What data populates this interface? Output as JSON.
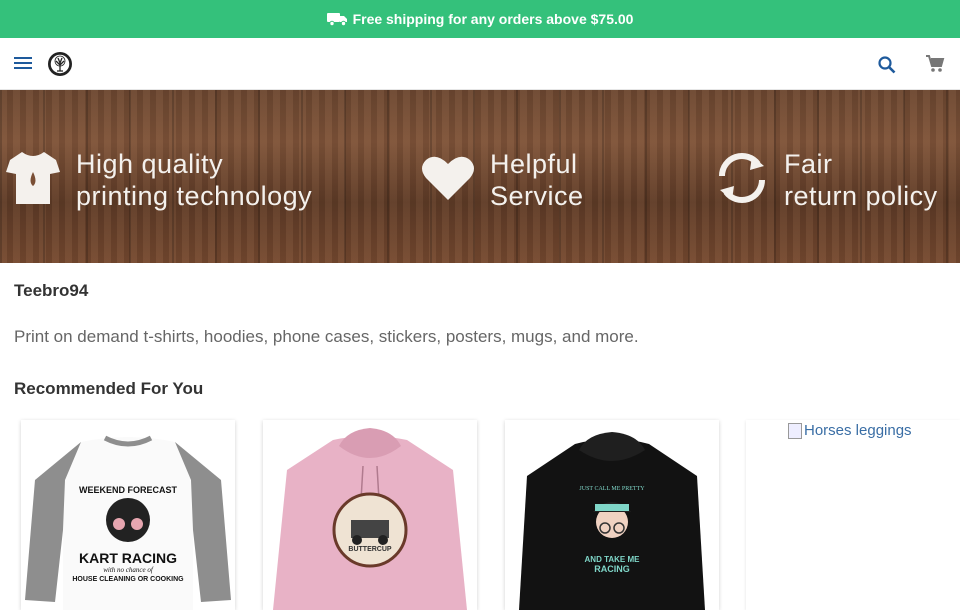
{
  "announcement": {
    "text": "Free shipping for any orders above $75.00",
    "icon": "truck-icon",
    "background": "#34c17b"
  },
  "header": {
    "menu_icon": "menu-icon",
    "logo_icon": "tree-logo-icon",
    "search_icon": "search-icon",
    "cart_icon": "cart-icon",
    "accent": "#1e5a9c"
  },
  "banner": {
    "features": [
      {
        "icon": "tshirt-icon",
        "line1": "High quality",
        "line2": "printing technology"
      },
      {
        "icon": "heart-icon",
        "line1": "Helpful",
        "line2": "Service"
      },
      {
        "icon": "refresh-icon",
        "line1": "Fair",
        "line2": "return policy"
      }
    ]
  },
  "store": {
    "name": "Teebro94",
    "description": "Print on demand t-shirts, hoodies, phone cases, stickers, posters, mugs, and more."
  },
  "recommended": {
    "title": "Recommended For You",
    "products": [
      {
        "image_text": [
          "WEEKEND FORECAST",
          "KART RACING",
          "with no chance of",
          "HOUSE CLEANING OR COOKING"
        ]
      },
      {
        "image_text": [
          "BUTTERCUP"
        ]
      },
      {
        "image_text": [
          "JUST CALL ME PRETTY",
          "AND TAKE ME",
          "RACING"
        ]
      },
      {
        "alt": "Horses leggings"
      }
    ]
  }
}
